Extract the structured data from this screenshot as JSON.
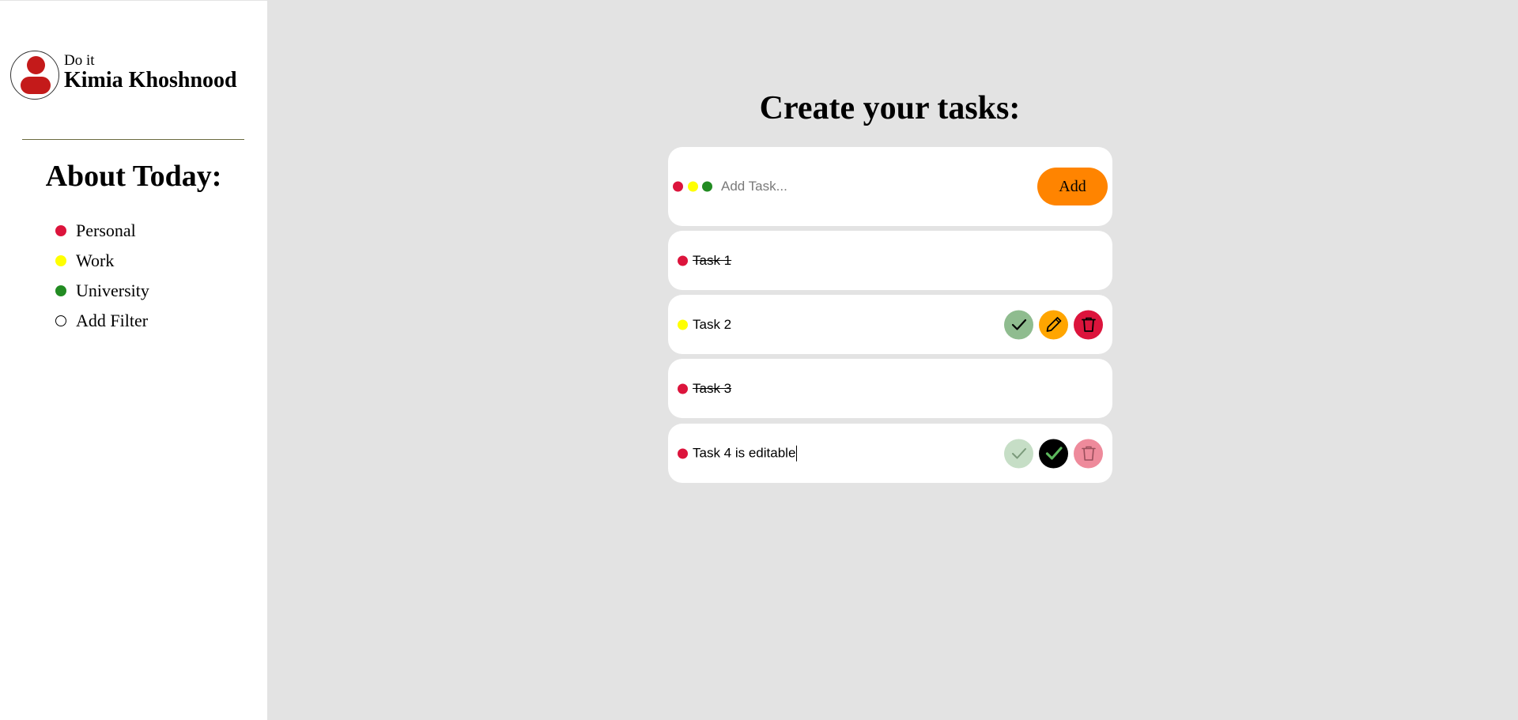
{
  "sidebar": {
    "app_name": "Do it",
    "user_name": "Kimia Khoshnood",
    "about_title": "About Today:",
    "filters": [
      {
        "label": "Personal",
        "color": "#dc143c"
      },
      {
        "label": "Work",
        "color": "#ffff00"
      },
      {
        "label": "University",
        "color": "#228b22"
      },
      {
        "label": "Add Filter",
        "color": "outline"
      }
    ]
  },
  "main": {
    "title": "Create your tasks:",
    "add_form": {
      "placeholder": "Add Task...",
      "value": "",
      "button_label": "Add",
      "category_colors": [
        "#dc143c",
        "#ffff00",
        "#228b22"
      ]
    },
    "tasks": [
      {
        "text": "Task 1",
        "color": "#dc143c",
        "done": true
      },
      {
        "text": "Task 2",
        "color": "#ffff00",
        "done": false,
        "actions": [
          "check-icon",
          "pencil-icon",
          "trash-icon"
        ]
      },
      {
        "text": "Task 3",
        "color": "#dc143c",
        "done": true
      },
      {
        "text": "Task 4 is editable",
        "color": "#dc143c",
        "done": false,
        "editing": true,
        "actions": [
          "check-icon",
          "save-check-icon",
          "trash-icon"
        ]
      }
    ]
  },
  "colors": {
    "accent": "#ff8400",
    "complete": "#8fbc8f",
    "edit": "#ffa500",
    "delete": "#dc143c"
  }
}
